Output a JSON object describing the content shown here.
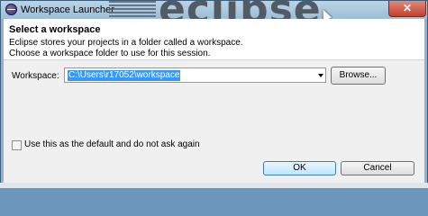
{
  "window": {
    "title": "Workspace Launcher",
    "splash_text": "eclipse"
  },
  "header": {
    "title": "Select a workspace",
    "line1": "Eclipse stores your projects in a folder called a workspace.",
    "line2": "Choose a workspace folder to use for this session."
  },
  "workspace": {
    "label": "Workspace:",
    "value": "C:\\Users\\r17052\\workspace",
    "browse_label": "Browse..."
  },
  "default_option": {
    "label": "Use this as the default and do not ask again",
    "checked": false
  },
  "buttons": {
    "ok": "OK",
    "cancel": "Cancel"
  }
}
